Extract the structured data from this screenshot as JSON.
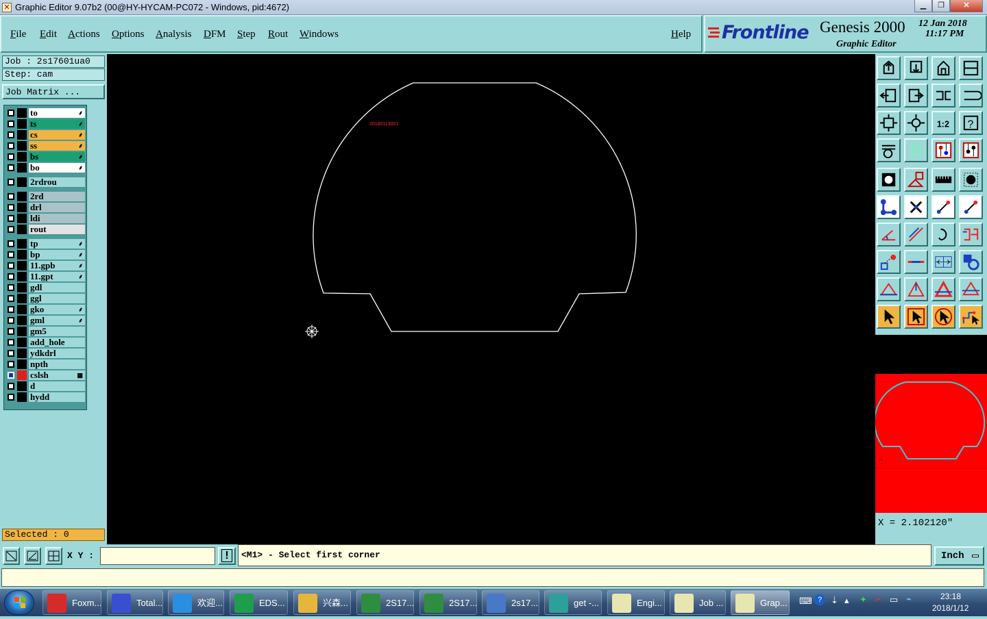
{
  "window": {
    "title": "Graphic Editor 9.07b2 (00@HY-HYCAM-PC072 - Windows, pid:4672)"
  },
  "menu": {
    "items": [
      "File",
      "Edit",
      "Actions",
      "Options",
      "Analysis",
      "DFM",
      "Step",
      "Rout",
      "Windows"
    ],
    "help": "Help"
  },
  "brand": {
    "logo": "Frontline",
    "product": "Genesis 2000",
    "subtitle": "Graphic Editor",
    "date": "12 Jan 2018",
    "time": "11:17 PM"
  },
  "job": {
    "job_label": "Job : 2s17601ua0",
    "step_label": "Step: cam",
    "matrix_button": "Job Matrix ..."
  },
  "layers": [
    {
      "name": "to",
      "color": "#ffffff",
      "mark": "⸙"
    },
    {
      "name": "ts",
      "color": "#1aa073",
      "mark": "⸙"
    },
    {
      "name": "cs",
      "color": "#f1b442",
      "mark": "⸙"
    },
    {
      "name": "ss",
      "color": "#f1b442",
      "mark": "⸙"
    },
    {
      "name": "bs",
      "color": "#1aa073",
      "mark": "⸙"
    },
    {
      "name": "bo",
      "color": "#ffffff",
      "mark": "⸙"
    },
    {
      "name": "2rdrou",
      "color": "#9fd8d8",
      "mark": ""
    },
    {
      "name": "2rd",
      "color": "#a8c2c8",
      "mark": ""
    },
    {
      "name": "drl",
      "color": "#a8c2c8",
      "mark": ""
    },
    {
      "name": "ldi",
      "color": "#a8c2c8",
      "mark": ""
    },
    {
      "name": "rout",
      "color": "#e2e2e2",
      "mark": ""
    },
    {
      "name": "tp",
      "color": "#9fd8d8",
      "mark": "⸙"
    },
    {
      "name": "bp",
      "color": "#9fd8d8",
      "mark": "⸙"
    },
    {
      "name": "11.gpb",
      "color": "#9fd8d8",
      "mark": "⸙"
    },
    {
      "name": "11.gpt",
      "color": "#9fd8d8",
      "mark": "⸙"
    },
    {
      "name": "gdl",
      "color": "#9fd8d8",
      "mark": ""
    },
    {
      "name": "ggl",
      "color": "#9fd8d8",
      "mark": ""
    },
    {
      "name": "gko",
      "color": "#9fd8d8",
      "mark": "⸙"
    },
    {
      "name": "gml",
      "color": "#9fd8d8",
      "mark": "⸙"
    },
    {
      "name": "gm5",
      "color": "#9fd8d8",
      "mark": ""
    },
    {
      "name": "add_hole",
      "color": "#9fd8d8",
      "mark": ""
    },
    {
      "name": "ydkdrl",
      "color": "#9fd8d8",
      "mark": ""
    },
    {
      "name": "npth",
      "color": "#9fd8d8",
      "mark": ""
    },
    {
      "name": "cslsh",
      "color": "#9fd8d8",
      "mark": "▦",
      "active": true
    },
    {
      "name": "d",
      "color": "#9fd8d8",
      "mark": ""
    },
    {
      "name": "hydd",
      "color": "#9fd8d8",
      "mark": ""
    }
  ],
  "selected": "Selected : 0",
  "canvas": {
    "label_text": "20180113001"
  },
  "coordinate": "X = 2.102120\"",
  "status": {
    "xy_label": "X Y :",
    "xy_value": "",
    "prompt": "<M1> - Select first corner",
    "units": "Inch"
  },
  "taskbar": {
    "items": [
      "Foxm...",
      "Total...",
      "欢迎...",
      "EDS...",
      "兴森...",
      "2S17...",
      "2S17...",
      "2s17...",
      "get -...",
      "Engi...",
      "Job ...",
      "Grap..."
    ],
    "time": "23:18",
    "date": "2018/1/12"
  }
}
